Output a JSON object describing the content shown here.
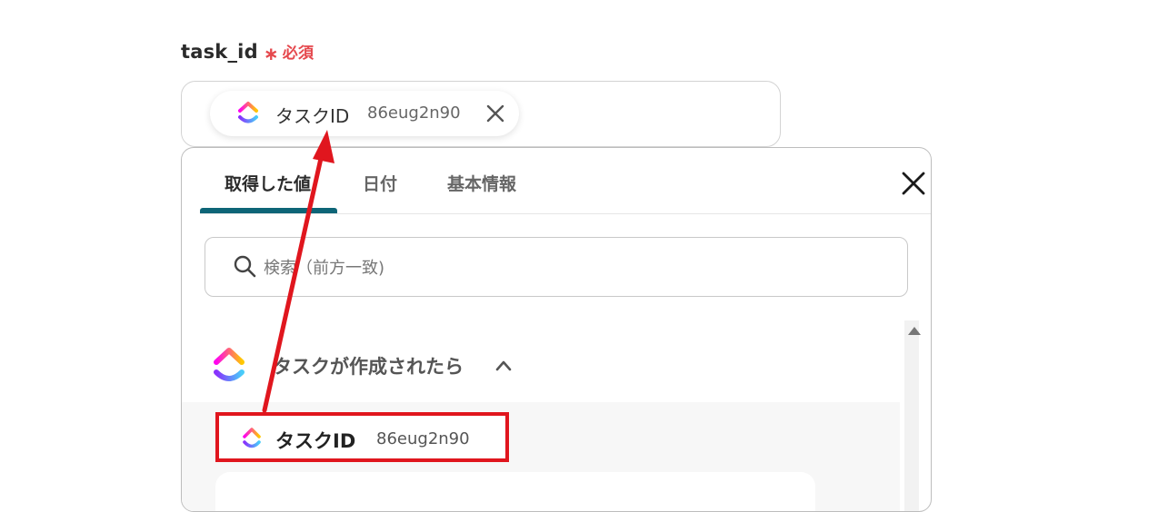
{
  "field": {
    "label": "task_id",
    "required_mark": "∗",
    "required_text": "必須"
  },
  "chip": {
    "logo": "clickup-logo",
    "label": "タスクID",
    "value": "86eug2n90",
    "close_icon": "close-icon"
  },
  "panel": {
    "tabs": [
      {
        "label": "取得した値",
        "active": true
      },
      {
        "label": "日付",
        "active": false
      },
      {
        "label": "基本情報",
        "active": false
      }
    ],
    "close_icon": "close-icon",
    "search": {
      "placeholder": "検索（前方一致)",
      "value": "",
      "icon": "search-icon"
    },
    "group": {
      "logo": "clickup-logo",
      "title": "タスクが作成されたら",
      "expand_icon": "chevron-up-icon"
    },
    "items": [
      {
        "logo": "clickup-logo",
        "label": "タスクID",
        "value": "86eug2n90",
        "highlighted": true
      }
    ]
  },
  "colors": {
    "required": "#e5484d",
    "tab_underline": "#0d6577",
    "highlight": "#e0161e",
    "arrow": "#e0161e"
  }
}
